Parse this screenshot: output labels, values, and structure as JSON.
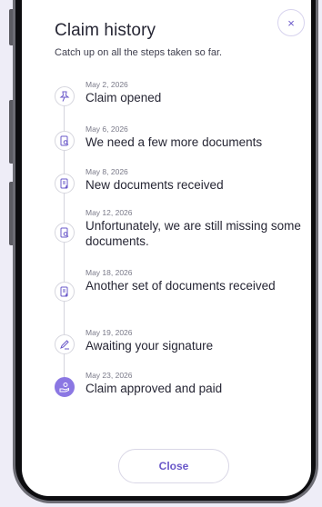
{
  "modal": {
    "title": "Claim history",
    "subtitle": "Catch up on all the steps taken so far.",
    "close_icon": "×",
    "close_button_label": "Close"
  },
  "colors": {
    "accent": "#8b77e3",
    "accent_text": "#6a58c9",
    "text": "#262634",
    "muted": "#7a7a89"
  },
  "timeline": [
    {
      "date": "May 2, 2026",
      "label": "Claim opened",
      "icon": "pin-icon"
    },
    {
      "date": "May 6, 2026",
      "label": "We need a few more documents",
      "icon": "document-search-icon"
    },
    {
      "date": "May 8, 2026",
      "label": "New documents received",
      "icon": "document-received-icon"
    },
    {
      "date": "May 12, 2026",
      "label": "Unfortunately, we are still missing some documents.",
      "icon": "document-search-icon"
    },
    {
      "date": "May 18, 2026",
      "label": "Another set of documents received",
      "icon": "document-received-icon"
    },
    {
      "date": "May 19, 2026",
      "label": "Awaiting your signature",
      "icon": "signature-pen-icon"
    },
    {
      "date": "May 23, 2026",
      "label": "Claim approved and paid",
      "icon": "payment-hand-icon",
      "active": true
    }
  ]
}
